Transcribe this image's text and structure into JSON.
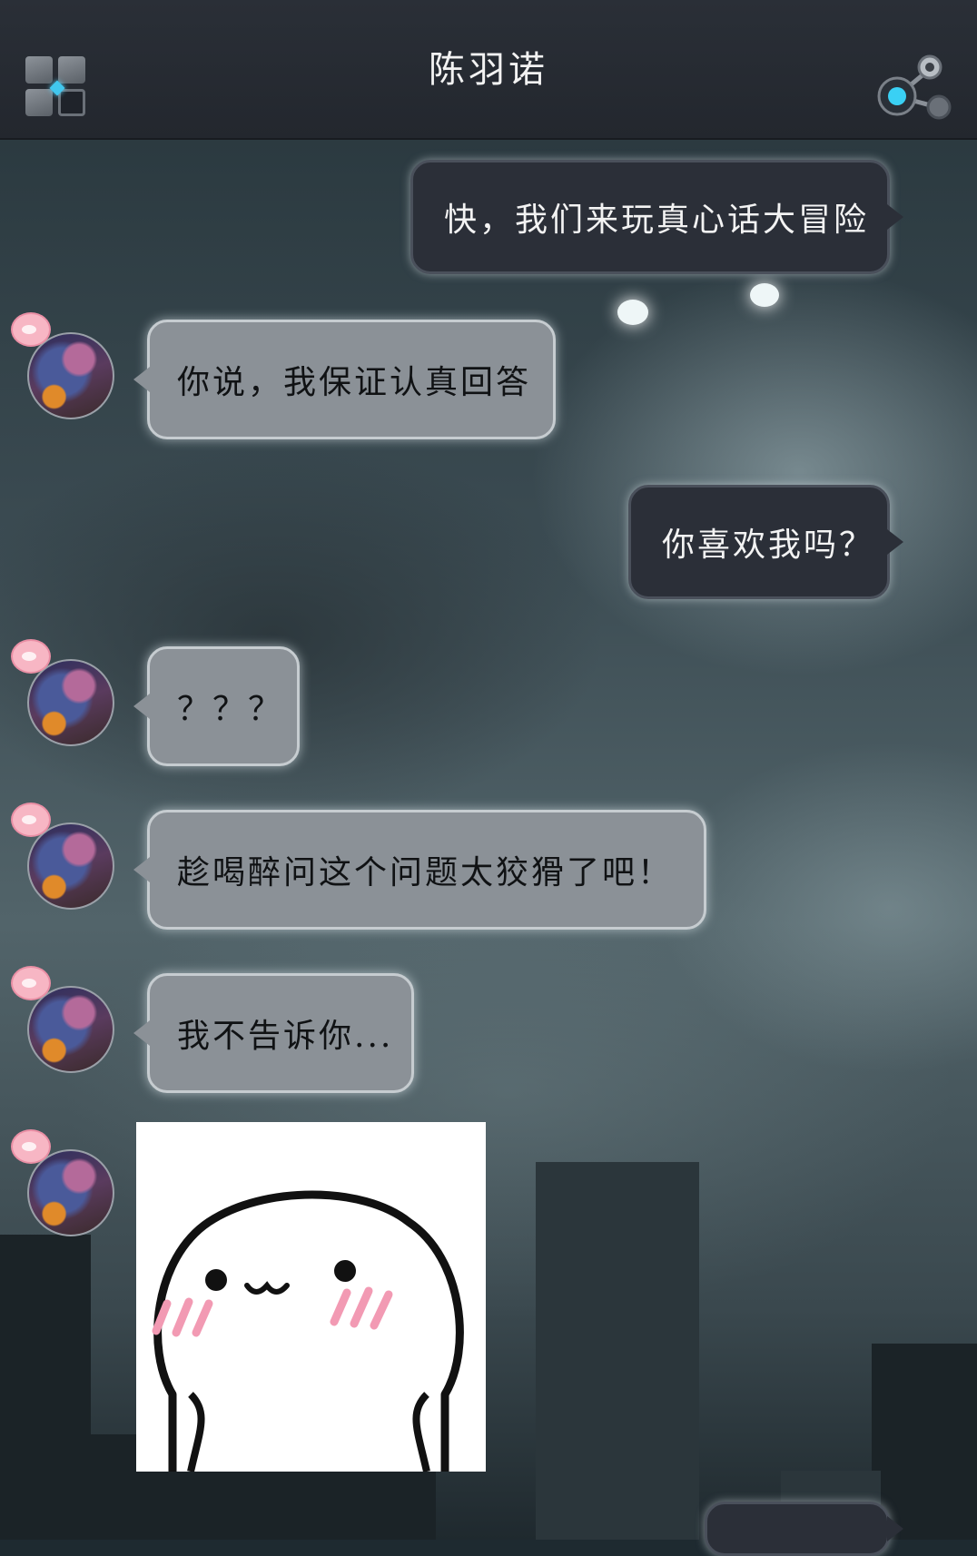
{
  "header": {
    "title": "陈羽诺"
  },
  "messages": [
    {
      "side": "out",
      "text": "快，我们来玩真心话大冒险"
    },
    {
      "side": "in",
      "text": "你说，我保证认真回答"
    },
    {
      "side": "out",
      "text": "你喜欢我吗？"
    },
    {
      "side": "in",
      "text": "？？？"
    },
    {
      "side": "in",
      "text": "趁喝醉问这个问题太狡猾了吧！"
    },
    {
      "side": "in",
      "text": "我不告诉你..."
    },
    {
      "side": "in",
      "sticker": "blushing-face-sticker"
    }
  ],
  "icons": {
    "menu": "grid-menu-icon",
    "share": "share-icon"
  }
}
